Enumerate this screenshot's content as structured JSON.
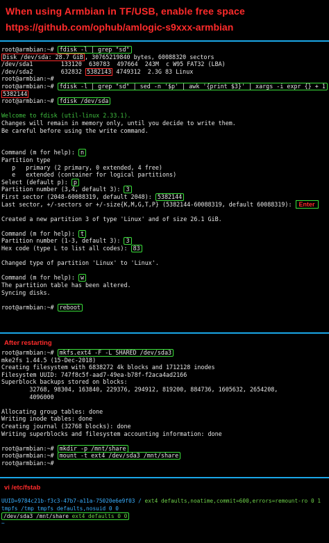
{
  "header": {
    "title": "When using Armbian in TF/USB, enable free space",
    "url": "https://github.com/ophub/amlogic-s9xxx-armbian"
  },
  "colors": {
    "accent": "#1aa7e8",
    "highlight_box": "#3be13b",
    "value_box": "#ff2b2b",
    "title_text": "#ff2b2b"
  },
  "block1": {
    "l1_prompt": "root@armbian:~# ",
    "l1_cmd": "fdisk -l | grep \"sd\"",
    "l2_boxed": "Disk /dev/sda: 28.7 GiB",
    "l2_rest": ", 30765219840 bytes, 60088320 sectors",
    "l3": "/dev/sda1        133120  630783  497664  243M  c W95 FAT32 (LBA)",
    "l4_pre": "/dev/sda2        632832 ",
    "l4_boxed": "5382143",
    "l4_post": " 4749312  2.3G 83 Linux",
    "l5_prompt": "root@armbian:~# ",
    "l6_prompt": "root@armbian:~# ",
    "l6_cmd": "fdisk -l | grep \"sd\" | sed -n '$p' | awk '{print $3}' | xargs -i expr {} + 1",
    "l7_boxed": "5382144",
    "l8_prompt": "root@armbian:~# ",
    "l8_cmd": "fdisk /dev/sda"
  },
  "fdisk": {
    "welcome": "Welcome to fdisk (util-linux 2.33.1).",
    "changes1": "Changes will remain in memory only, until you decide to write them.",
    "changes2": "Be careful before using the write command.",
    "cmd1_label": "Command (m for help): ",
    "cmd1_value": "n",
    "ptype": "Partition type",
    "p_opt": "   p   primary (2 primary, 0 extended, 4 free)",
    "e_opt": "   e   extended (container for logical partitions)",
    "select_label": "Select (default p): ",
    "select_value": "p",
    "partnum_label": "Partition number (3,4, default 3): ",
    "partnum_value": "3",
    "first_label": "First sector (2048-60088319, default 2048): ",
    "first_value": "5382144",
    "last_label": "Last sector, +/-sectors or +/-size{K,M,G,T,P} (5382144-60088319, default 60088319): ",
    "enter_label": "Enter",
    "created": "Created a new partition 3 of type 'Linux' and of size 26.1 GiB.",
    "cmd2_label": "Command (m for help): ",
    "cmd2_value": "t",
    "partnum2_label": "Partition number (1-3, default 3): ",
    "partnum2_value": "3",
    "hex_label": "Hex code (type L to list all codes): ",
    "hex_value": "83",
    "changed": "Changed type of partition 'Linux' to 'Linux'.",
    "cmd3_label": "Command (m for help): ",
    "cmd3_value": "w",
    "altered": "The partition table has been altered.",
    "syncing": "Syncing disks.",
    "reboot_prompt": "root@armbian:~# ",
    "reboot_cmd": "reboot"
  },
  "after": {
    "label": "After restarting",
    "p1": "root@armbian:~# ",
    "mkfs_cmd": "mkfs.ext4 -F -L SHARED /dev/sda3",
    "mke2fs": "mke2fs 1.44.5 (15-Dec-2018)",
    "creating": "Creating filesystem with 6838272 4k blocks and 1712128 inodes",
    "uuid": "Filesystem UUID: 747f8c5f-aad7-49ea-b78f-f2aca4ad2166",
    "backups": "Superblock backups stored on blocks:",
    "blocks1": "        32768, 98304, 163840, 229376, 294912, 819200, 884736, 1605632, 2654208,",
    "blocks2": "        4096000",
    "alloc": "Allocating group tables: done",
    "inode": "Writing inode tables: done",
    "journal": "Creating journal (32768 blocks): done",
    "superblocks": "Writing superblocks and filesystem accounting information: done",
    "p2": "root@armbian:~# ",
    "mkdir_cmd": "mkdir -p /mnt/share",
    "p3": "root@armbian:~# ",
    "mount_cmd": "mount -t ext4 /dev/sda3 /mnt/share",
    "p4": "root@armbian:~# "
  },
  "fstab": {
    "label": "vi /etc/fstab",
    "l1_uuid": "UUID=9784c21b-f3c3-47b7-a11a-75020e6e9f03 / ",
    "l1_rest": "ext4 defaults,noatime,commit=600,errors=remount-ro 0 1",
    "l2_tmp": "tmpfs /tmp ",
    "l2_rest": "tmpfs defaults,nosuid 0 0",
    "l3_path": "/dev/sda3 /mnt/share ",
    "l3_rest": "ext4 defaults 0 0",
    "l4": "~"
  }
}
